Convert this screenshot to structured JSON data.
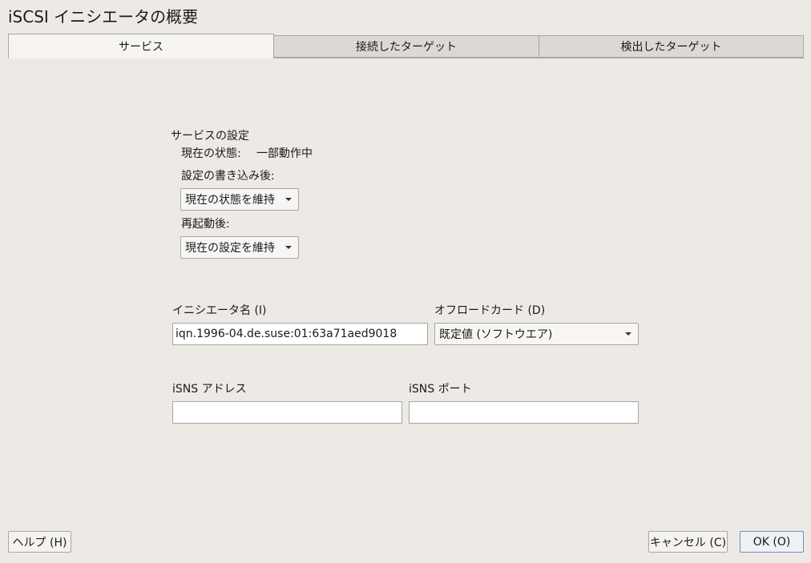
{
  "window": {
    "title": "iSCSI イニシエータの概要"
  },
  "tabs": [
    {
      "label": "サービス",
      "active": true
    },
    {
      "label": "接続したターゲット",
      "active": false
    },
    {
      "label": "検出したターゲット",
      "active": false
    }
  ],
  "service": {
    "section_title": "サービスの設定",
    "current_status_label": "現在の状態:",
    "current_status_value": "一部動作中",
    "after_write_label": "設定の書き込み後:",
    "after_write_value": "現在の状態を維持",
    "after_reboot_label": "再起動後:",
    "after_reboot_value": "現在の設定を維持"
  },
  "initiator": {
    "name_label": "イニシエータ名 (I)",
    "name_value": "iqn.1996-04.de.suse:01:63a71aed9018",
    "offload_label": "オフロードカード (D)",
    "offload_value": "既定値 (ソフトウエア)"
  },
  "isns": {
    "address_label": "iSNS アドレス",
    "address_value": "",
    "port_label": "iSNS ポート",
    "port_value": ""
  },
  "buttons": {
    "help": "ヘルプ (H)",
    "cancel": "キャンセル (C)",
    "ok": "OK (O)"
  }
}
